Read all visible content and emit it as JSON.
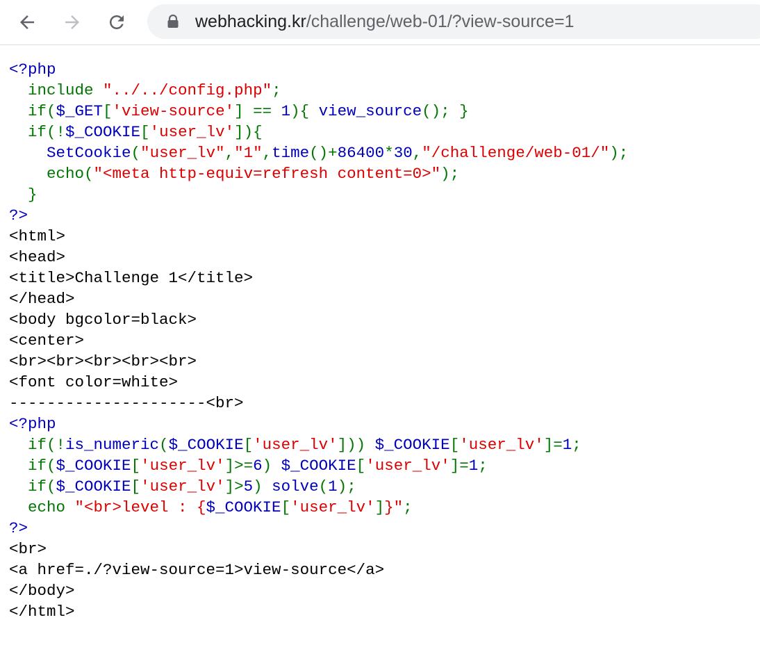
{
  "browser": {
    "url_host": "webhacking.kr",
    "url_path": "/challenge/web-01/?view-source=1"
  },
  "icons": {
    "back": "arrow-left-icon",
    "forward": "arrow-right-icon",
    "reload": "reload-icon",
    "lock": "lock-icon"
  },
  "colors": {
    "php_tag": "#0000BB",
    "php_keyword": "#007700",
    "php_string": "#DD0000",
    "html": "#000000",
    "omnibox_bg": "#f1f3f4"
  },
  "source_lines": [
    [
      {
        "t": "<?php",
        "c": "blue"
      }
    ],
    [
      {
        "t": "  include ",
        "c": "green"
      },
      {
        "t": "\"../../config.php\"",
        "c": "red"
      },
      {
        "t": ";",
        "c": "green"
      }
    ],
    [
      {
        "t": "  if(",
        "c": "green"
      },
      {
        "t": "$_GET",
        "c": "blue"
      },
      {
        "t": "[",
        "c": "green"
      },
      {
        "t": "'view-source'",
        "c": "red"
      },
      {
        "t": "] == ",
        "c": "green"
      },
      {
        "t": "1",
        "c": "blue"
      },
      {
        "t": "){ ",
        "c": "green"
      },
      {
        "t": "view_source",
        "c": "blue"
      },
      {
        "t": "(); }",
        "c": "green"
      }
    ],
    [
      {
        "t": "  if(!",
        "c": "green"
      },
      {
        "t": "$_COOKIE",
        "c": "blue"
      },
      {
        "t": "[",
        "c": "green"
      },
      {
        "t": "'user_lv'",
        "c": "red"
      },
      {
        "t": "]){",
        "c": "green"
      }
    ],
    [
      {
        "t": "    ",
        "c": "green"
      },
      {
        "t": "SetCookie",
        "c": "blue"
      },
      {
        "t": "(",
        "c": "green"
      },
      {
        "t": "\"user_lv\"",
        "c": "red"
      },
      {
        "t": ",",
        "c": "green"
      },
      {
        "t": "\"1\"",
        "c": "red"
      },
      {
        "t": ",",
        "c": "green"
      },
      {
        "t": "time",
        "c": "blue"
      },
      {
        "t": "()+",
        "c": "green"
      },
      {
        "t": "86400",
        "c": "blue"
      },
      {
        "t": "*",
        "c": "green"
      },
      {
        "t": "30",
        "c": "blue"
      },
      {
        "t": ",",
        "c": "green"
      },
      {
        "t": "\"/challenge/web-01/\"",
        "c": "red"
      },
      {
        "t": ");",
        "c": "green"
      }
    ],
    [
      {
        "t": "    echo(",
        "c": "green"
      },
      {
        "t": "\"<meta http-equiv=refresh content=0>\"",
        "c": "red"
      },
      {
        "t": ");",
        "c": "green"
      }
    ],
    [
      {
        "t": "  }",
        "c": "green"
      }
    ],
    [
      {
        "t": "?>",
        "c": "blue"
      }
    ],
    [
      {
        "t": "<html>",
        "c": "black"
      }
    ],
    [
      {
        "t": "<head>",
        "c": "black"
      }
    ],
    [
      {
        "t": "<title>Challenge 1</title>",
        "c": "black"
      }
    ],
    [
      {
        "t": "</head>",
        "c": "black"
      }
    ],
    [
      {
        "t": "<body bgcolor=black>",
        "c": "black"
      }
    ],
    [
      {
        "t": "<center>",
        "c": "black"
      }
    ],
    [
      {
        "t": "<br><br><br><br><br>",
        "c": "black"
      }
    ],
    [
      {
        "t": "<font color=white>",
        "c": "black"
      }
    ],
    [
      {
        "t": "---------------------<br>",
        "c": "black"
      }
    ],
    [
      {
        "t": "<?php",
        "c": "blue"
      }
    ],
    [
      {
        "t": "  if(!",
        "c": "green"
      },
      {
        "t": "is_numeric",
        "c": "blue"
      },
      {
        "t": "(",
        "c": "green"
      },
      {
        "t": "$_COOKIE",
        "c": "blue"
      },
      {
        "t": "[",
        "c": "green"
      },
      {
        "t": "'user_lv'",
        "c": "red"
      },
      {
        "t": "])) ",
        "c": "green"
      },
      {
        "t": "$_COOKIE",
        "c": "blue"
      },
      {
        "t": "[",
        "c": "green"
      },
      {
        "t": "'user_lv'",
        "c": "red"
      },
      {
        "t": "]=",
        "c": "green"
      },
      {
        "t": "1",
        "c": "blue"
      },
      {
        "t": ";",
        "c": "green"
      }
    ],
    [
      {
        "t": "  if(",
        "c": "green"
      },
      {
        "t": "$_COOKIE",
        "c": "blue"
      },
      {
        "t": "[",
        "c": "green"
      },
      {
        "t": "'user_lv'",
        "c": "red"
      },
      {
        "t": "]>=",
        "c": "green"
      },
      {
        "t": "6",
        "c": "blue"
      },
      {
        "t": ") ",
        "c": "green"
      },
      {
        "t": "$_COOKIE",
        "c": "blue"
      },
      {
        "t": "[",
        "c": "green"
      },
      {
        "t": "'user_lv'",
        "c": "red"
      },
      {
        "t": "]=",
        "c": "green"
      },
      {
        "t": "1",
        "c": "blue"
      },
      {
        "t": ";",
        "c": "green"
      }
    ],
    [
      {
        "t": "  if(",
        "c": "green"
      },
      {
        "t": "$_COOKIE",
        "c": "blue"
      },
      {
        "t": "[",
        "c": "green"
      },
      {
        "t": "'user_lv'",
        "c": "red"
      },
      {
        "t": "]>",
        "c": "green"
      },
      {
        "t": "5",
        "c": "blue"
      },
      {
        "t": ") ",
        "c": "green"
      },
      {
        "t": "solve",
        "c": "blue"
      },
      {
        "t": "(",
        "c": "green"
      },
      {
        "t": "1",
        "c": "blue"
      },
      {
        "t": ");",
        "c": "green"
      }
    ],
    [
      {
        "t": "  echo ",
        "c": "green"
      },
      {
        "t": "\"<br>level : {",
        "c": "red"
      },
      {
        "t": "$_COOKIE",
        "c": "blue"
      },
      {
        "t": "[",
        "c": "green"
      },
      {
        "t": "'user_lv'",
        "c": "red"
      },
      {
        "t": "]",
        "c": "green"
      },
      {
        "t": "}\"",
        "c": "red"
      },
      {
        "t": ";",
        "c": "green"
      }
    ],
    [
      {
        "t": "?>",
        "c": "blue"
      }
    ],
    [
      {
        "t": "<br>",
        "c": "black"
      }
    ],
    [
      {
        "t": "<a href=./?view-source=1>view-source</a>",
        "c": "black"
      }
    ],
    [
      {
        "t": "</body>",
        "c": "black"
      }
    ],
    [
      {
        "t": "</html>",
        "c": "black"
      }
    ]
  ]
}
